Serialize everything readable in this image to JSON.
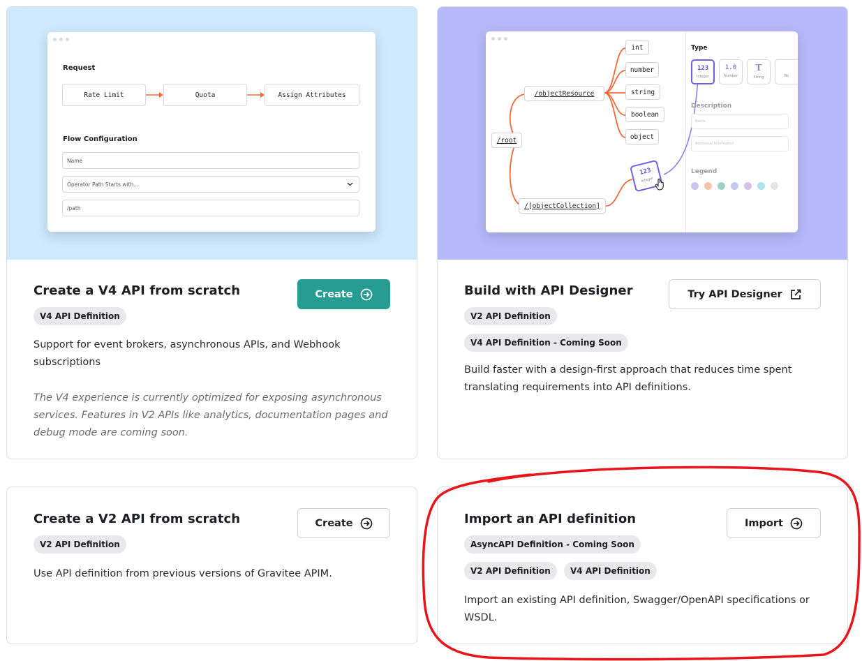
{
  "cards": {
    "v4": {
      "title": "Create a V4 API from scratch",
      "button_label": "Create",
      "badges": [
        "V4 API Definition"
      ],
      "description": "Support for event brokers, asynchronous APIs, and Webhook subscriptions",
      "note": "The V4 experience is currently optimized for exposing asynchronous services. Features in V2 APIs like analytics, documentation pages and debug mode are coming soon.",
      "mockup": {
        "request_heading": "Request",
        "steps": [
          "Rate Limit",
          "Quota",
          "Assign Attributes"
        ],
        "flow_heading": "Flow Configuration",
        "name_field": "Name",
        "operator_field": "Operator Path Starts with...",
        "path_field": "/path"
      }
    },
    "designer": {
      "title": "Build with API Designer",
      "button_label": "Try API Designer",
      "badges": [
        "V2 API Definition",
        "V4 API Definition - Coming Soon"
      ],
      "description": "Build faster with a design-first approach that reduces time spent translating requirements into API definitions.",
      "mockup": {
        "root": "/root",
        "object_resource": "/objectResource",
        "object_collection": "/[objectCollection]",
        "leaf_types": [
          "int",
          "number",
          "string",
          "boolean",
          "object"
        ],
        "drag_tile": {
          "value": "123",
          "label": "Integer"
        },
        "type_heading": "Type",
        "type_tiles": [
          {
            "value": "123",
            "label": "Integer"
          },
          {
            "value": "1.0",
            "label": "Number"
          },
          {
            "value": "T",
            "label": "String"
          },
          {
            "value": "B",
            "label": "Bo"
          }
        ],
        "description_heading": "Description",
        "name_placeholder": "Name",
        "info_placeholder": "Additional Information",
        "legend_heading": "Legend",
        "legend_colors": [
          "#c9c6f3",
          "#f7c3a7",
          "#9ed1c6",
          "#c3cbf0",
          "#d3c2ea",
          "#a9e4f0",
          "#e3e4e9"
        ]
      }
    },
    "v2": {
      "title": "Create a V2 API from scratch",
      "button_label": "Create",
      "badges": [
        "V2 API Definition"
      ],
      "description": "Use API definition from previous versions of Gravitee APIM."
    },
    "import": {
      "title": "Import an API definition",
      "button_label": "Import",
      "badges": [
        "AsyncAPI Definition - Coming Soon",
        "V2 API Definition",
        "V4 API Definition"
      ],
      "description": "Import an existing API definition, Swagger/OpenAPI specifications or WSDL."
    }
  },
  "colors": {
    "primary_button": "#279c93",
    "highlight_circle": "#e8141b",
    "hero_blue": "#cde9fb",
    "hero_purple": "#b6b9f9",
    "flow_line": "#f06a3a",
    "designer_accent": "#6b63e0"
  },
  "icons": {
    "arrow_circle": "arrow-right-circle-icon",
    "external_link": "external-link-icon"
  }
}
